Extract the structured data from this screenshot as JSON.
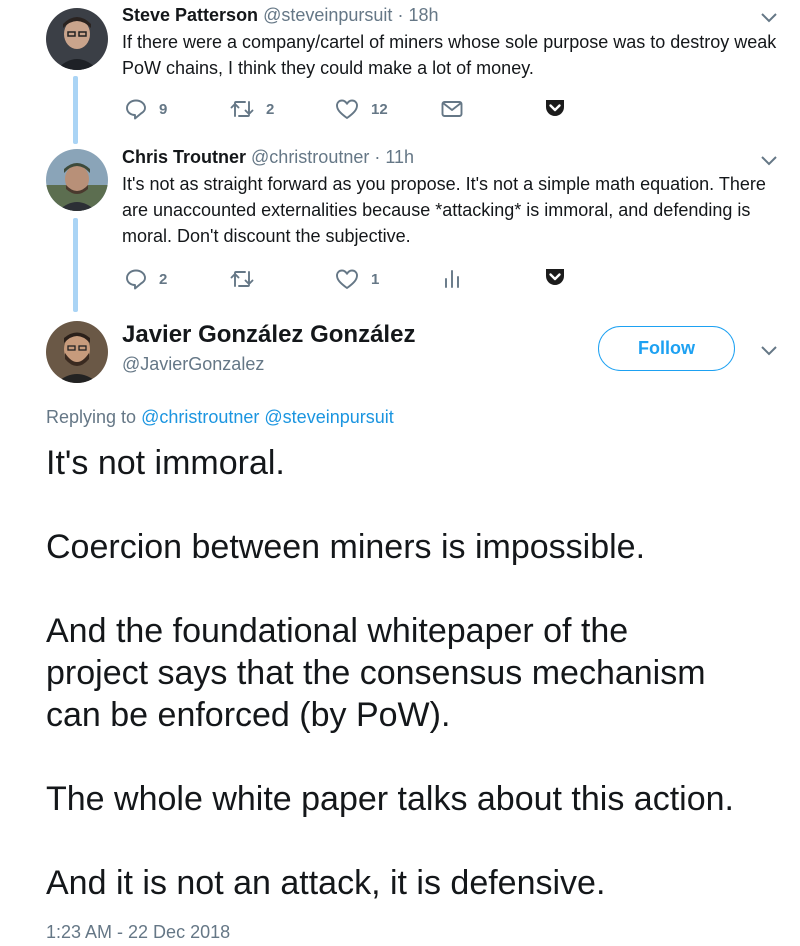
{
  "tweets": [
    {
      "name": "Steve Patterson",
      "handle": "@steveinpursuit",
      "separator": "·",
      "time": "18h",
      "text": "If there were a company/cartel of miners whose sole purpose was to destroy weak PoW chains, I think they could make a lot of money.",
      "replies": "9",
      "retweets": "2",
      "likes": "12"
    },
    {
      "name": "Chris Troutner",
      "handle": "@christroutner",
      "separator": "·",
      "time": "11h",
      "text": "It's not as straight forward as you propose. It's not a simple math equation. There are unaccounted externalities because *attacking* is immoral, and defending is moral. Don't discount the subjective.",
      "replies": "2",
      "retweets": "",
      "likes": "1"
    }
  ],
  "main": {
    "name": "Javier González González",
    "handle": "@JavierGonzalez",
    "follow_label": "Follow",
    "replying_prefix": "Replying to",
    "replying_to": [
      "@christroutner",
      "@steveinpursuit"
    ],
    "paragraphs": [
      "It's not immoral.",
      "Coercion between miners is impossible.",
      "And the foundational whitepaper of the",
      "project says that the consensus mechanism",
      "can be enforced (by PoW).",
      "The whole white paper talks about this action.",
      "And it is not an attack, it is defensive."
    ],
    "timestamp": "1:23 AM - 22 Dec 2018"
  },
  "icons": {
    "reply": "reply-icon",
    "retweet": "retweet-icon",
    "like": "heart-icon",
    "dm": "envelope-icon",
    "analytics": "analytics-icon",
    "pocket": "pocket-icon",
    "caret": "chevron-down-icon"
  },
  "colors": {
    "accent": "#1da1f2",
    "link": "#1b95e0",
    "muted": "#657786",
    "thread_line": "#aad4f5",
    "pocket": "#1c1c1c"
  }
}
